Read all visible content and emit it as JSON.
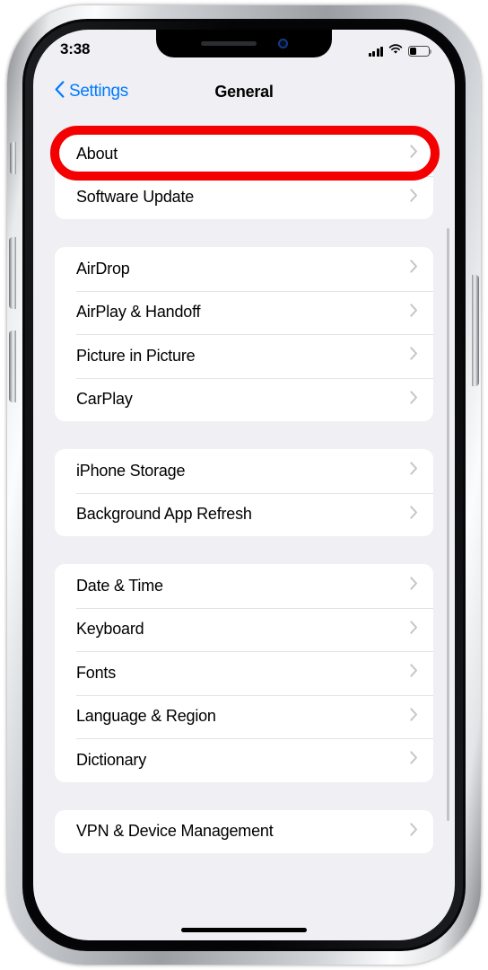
{
  "status_bar": {
    "time": "3:38",
    "signal_icon": "cellular-signal-icon",
    "wifi_icon": "wifi-icon",
    "battery_icon": "battery-icon",
    "battery_level_percent": 30
  },
  "nav_bar": {
    "back_label": "Settings",
    "back_icon": "chevron-left-icon",
    "title": "General"
  },
  "highlight": {
    "target_row": "About",
    "color": "#f40000",
    "shape": "rounded-oval-outline"
  },
  "sections": [
    {
      "rows": [
        {
          "label": "About",
          "accessory": "chevron-right-icon",
          "highlighted": true
        },
        {
          "label": "Software Update",
          "accessory": "chevron-right-icon",
          "highlighted": false
        }
      ]
    },
    {
      "rows": [
        {
          "label": "AirDrop",
          "accessory": "chevron-right-icon",
          "highlighted": false
        },
        {
          "label": "AirPlay & Handoff",
          "accessory": "chevron-right-icon",
          "highlighted": false
        },
        {
          "label": "Picture in Picture",
          "accessory": "chevron-right-icon",
          "highlighted": false
        },
        {
          "label": "CarPlay",
          "accessory": "chevron-right-icon",
          "highlighted": false
        }
      ]
    },
    {
      "rows": [
        {
          "label": "iPhone Storage",
          "accessory": "chevron-right-icon",
          "highlighted": false
        },
        {
          "label": "Background App Refresh",
          "accessory": "chevron-right-icon",
          "highlighted": false
        }
      ]
    },
    {
      "rows": [
        {
          "label": "Date & Time",
          "accessory": "chevron-right-icon",
          "highlighted": false
        },
        {
          "label": "Keyboard",
          "accessory": "chevron-right-icon",
          "highlighted": false
        },
        {
          "label": "Fonts",
          "accessory": "chevron-right-icon",
          "highlighted": false
        },
        {
          "label": "Language & Region",
          "accessory": "chevron-right-icon",
          "highlighted": false
        },
        {
          "label": "Dictionary",
          "accessory": "chevron-right-icon",
          "highlighted": false
        }
      ]
    },
    {
      "rows": [
        {
          "label": "VPN & Device Management",
          "accessory": "chevron-right-icon",
          "highlighted": false
        }
      ]
    }
  ],
  "colors": {
    "accent_blue": "#007aff",
    "screen_background": "#efeff4",
    "card_background": "#ffffff",
    "highlight_red": "#f40000"
  }
}
